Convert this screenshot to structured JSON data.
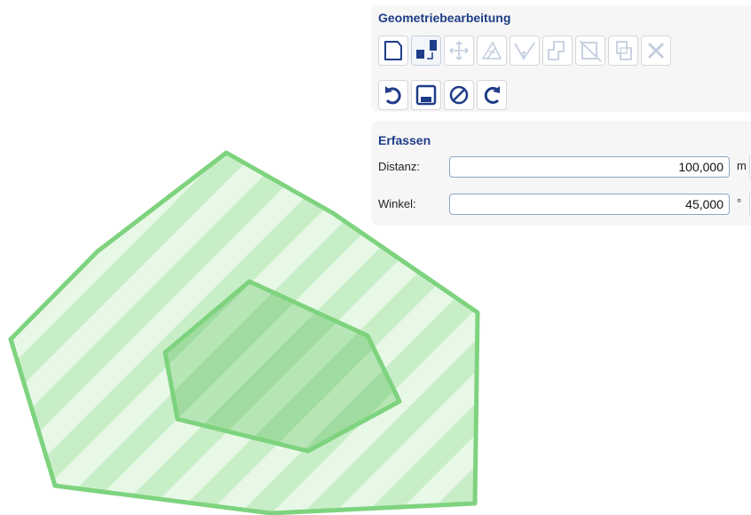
{
  "geometry_panel": {
    "title": "Geometriebearbeitung",
    "row1_tools": [
      {
        "name": "draw-polygon",
        "state": "enabled"
      },
      {
        "name": "snap-vertex",
        "state": "active"
      },
      {
        "name": "move",
        "state": "disabled"
      },
      {
        "name": "rotate",
        "state": "disabled"
      },
      {
        "name": "angle-construct",
        "state": "disabled"
      },
      {
        "name": "polygon-add",
        "state": "disabled"
      },
      {
        "name": "polygon-cut",
        "state": "disabled"
      },
      {
        "name": "polygon-subtract",
        "state": "disabled"
      },
      {
        "name": "delete",
        "state": "disabled"
      }
    ],
    "row2_tools": [
      {
        "name": "undo",
        "state": "enabled"
      },
      {
        "name": "save",
        "state": "enabled"
      },
      {
        "name": "cancel",
        "state": "enabled"
      },
      {
        "name": "redo",
        "state": "enabled"
      }
    ]
  },
  "capture_panel": {
    "title": "Erfassen",
    "distance": {
      "label": "Distanz:",
      "value": "100,000",
      "unit": "m"
    },
    "angle": {
      "label": "Winkel:",
      "value": "45,000",
      "unit": "°"
    }
  },
  "colors": {
    "accent": "#1f3c88",
    "polygon_stroke": "#7ed37e",
    "polygon_fill_light": "#e4f7e4",
    "polygon_fill_stripe": "#c7edc7"
  }
}
